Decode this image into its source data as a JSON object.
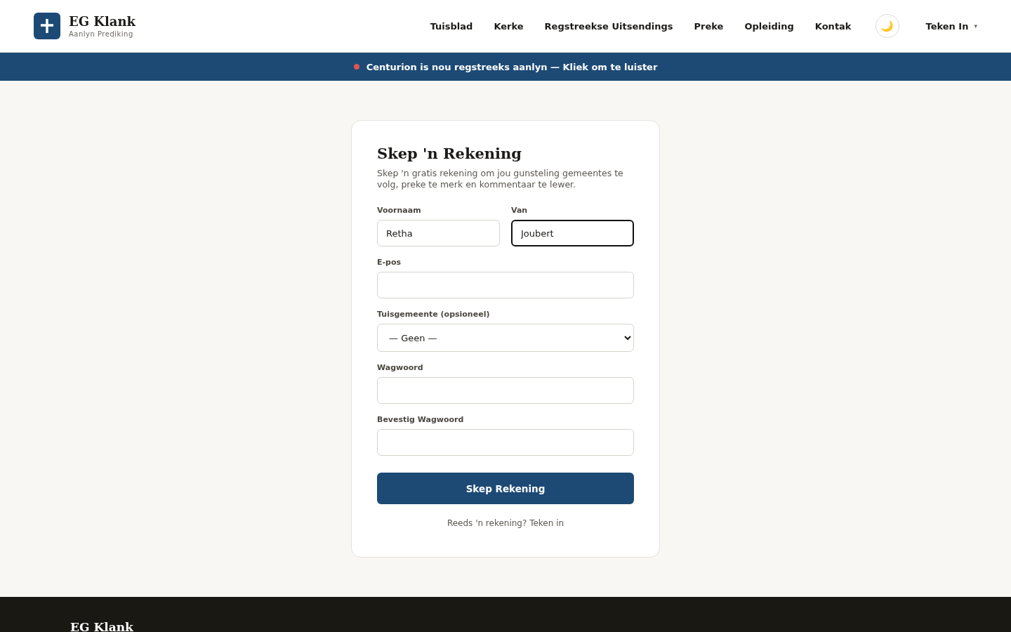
{
  "header": {
    "brand": {
      "title": "EG Klank",
      "subtitle": "Aanlyn Prediking"
    },
    "nav": [
      {
        "label": "Tuisblad"
      },
      {
        "label": "Kerke"
      },
      {
        "label": "Regstreekse Uitsendings"
      },
      {
        "label": "Preke"
      },
      {
        "label": "Opleiding"
      },
      {
        "label": "Kontak"
      }
    ],
    "theme_toggle": {
      "icon": "🌙"
    },
    "account_menu": {
      "label": "Teken In",
      "caret": "▾"
    }
  },
  "live_banner": {
    "text": "Centurion is nou regstreeks aanlyn — Kliek om te luister"
  },
  "form": {
    "title": "Skep 'n Rekening",
    "description": "Skep 'n gratis rekening om jou gunsteling gemeentes te volg, preke te merk en kommentaar te lewer.",
    "name_row": [
      {
        "label": "Voornaam",
        "value": "Retha",
        "focused": false
      },
      {
        "label": "Van",
        "value": "Joubert",
        "focused": true
      }
    ],
    "fields": [
      {
        "kind": "text",
        "label": "E-pos"
      },
      {
        "kind": "select",
        "label": "Tuisgemeente (opsioneel)",
        "value": "— Geen —"
      },
      {
        "kind": "password",
        "label": "Wagwoord"
      },
      {
        "kind": "password",
        "label": "Bevestig Wagwoord"
      }
    ],
    "submit": "Skep Rekening",
    "footer_link": "Reeds 'n rekening? Teken in"
  },
  "footer": {
    "title": "EG Klank"
  }
}
